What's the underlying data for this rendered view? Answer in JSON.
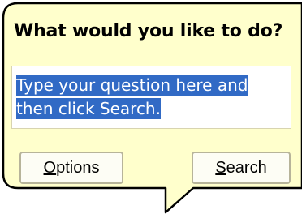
{
  "dialog": {
    "title": "What would you like to do?",
    "background_color": "#ffffcc",
    "border_color": "#000000"
  },
  "search": {
    "value_line1": "Type your question here and",
    "value_line2": "then click Search.",
    "selection_color": "#316ac5"
  },
  "buttons": {
    "options_mnemonic": "O",
    "options_rest": "ptions",
    "search_mnemonic": "S",
    "search_rest": "earch"
  }
}
